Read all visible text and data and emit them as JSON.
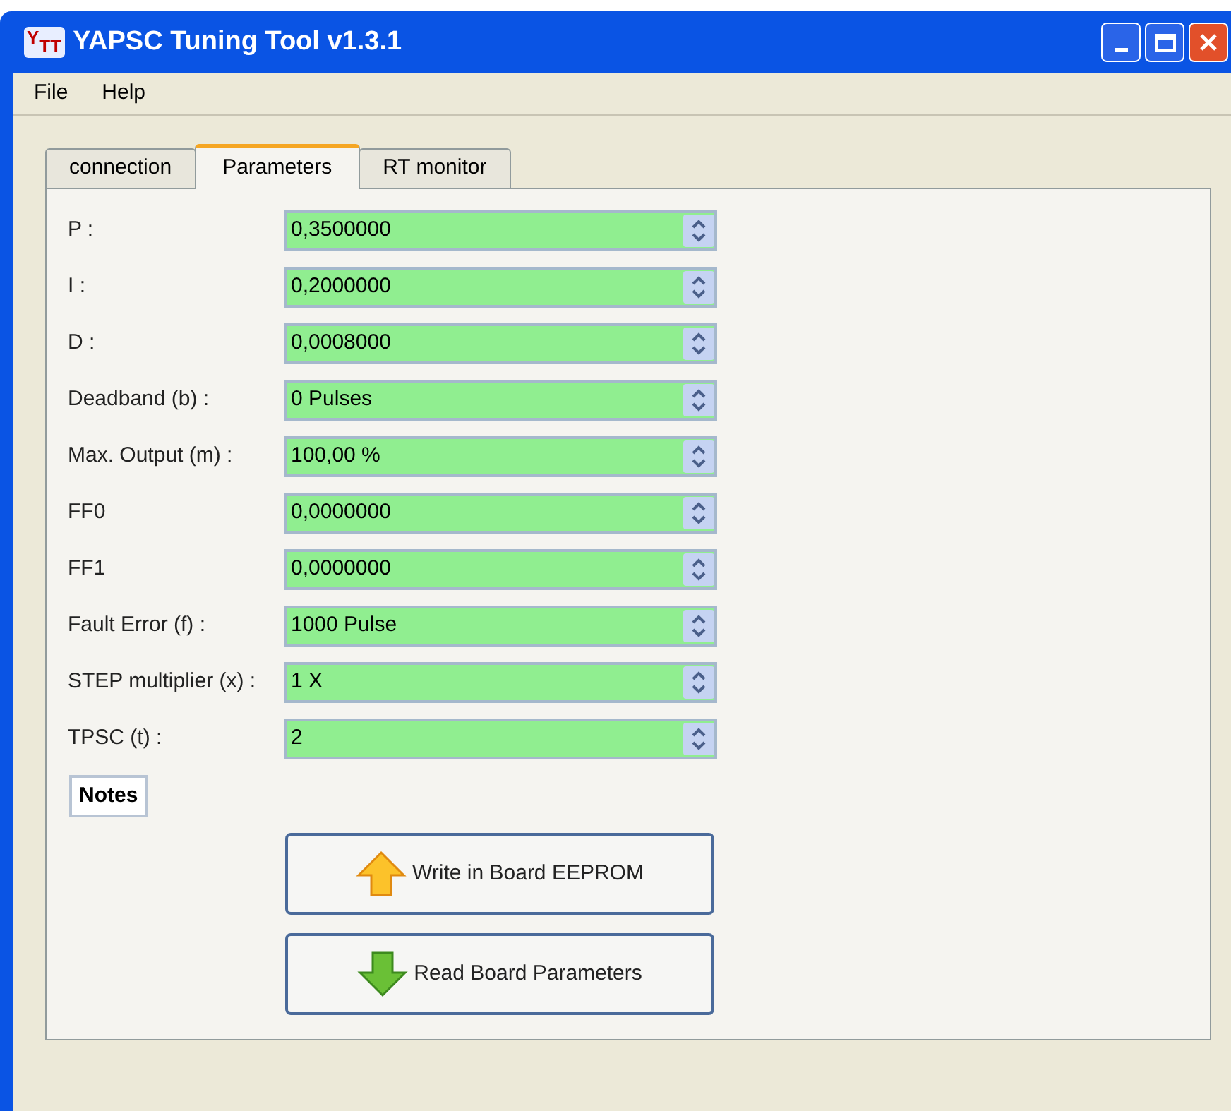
{
  "window": {
    "logo": "YTT",
    "title": "YAPSC Tuning Tool v1.3.1"
  },
  "menu": [
    "File",
    "Help"
  ],
  "tabs": [
    {
      "label": "connection",
      "selected": false
    },
    {
      "label": "Parameters",
      "selected": true
    },
    {
      "label": "RT monitor",
      "selected": false
    }
  ],
  "parameters": [
    {
      "label": "P :",
      "value": "0,3500000"
    },
    {
      "label": "I :",
      "value": "0,2000000"
    },
    {
      "label": "D :",
      "value": "0,0008000"
    },
    {
      "label": "Deadband (b) :",
      "value": "0 Pulses"
    },
    {
      "label": "Max. Output (m) :",
      "value": "100,00 %"
    },
    {
      "label": "FF0",
      "value": "0,0000000"
    },
    {
      "label": "FF1",
      "value": "0,0000000"
    },
    {
      "label": "Fault Error (f) :",
      "value": "1000 Pulse"
    },
    {
      "label": "STEP multiplier (x) :",
      "value": "1 X"
    },
    {
      "label": "TPSC (t) :",
      "value": "2"
    }
  ],
  "notes_button": "Notes",
  "buttons": [
    {
      "label": "Write in Board EEPROM",
      "kind": "up"
    },
    {
      "label": "Read Board Parameters",
      "kind": "down"
    }
  ]
}
